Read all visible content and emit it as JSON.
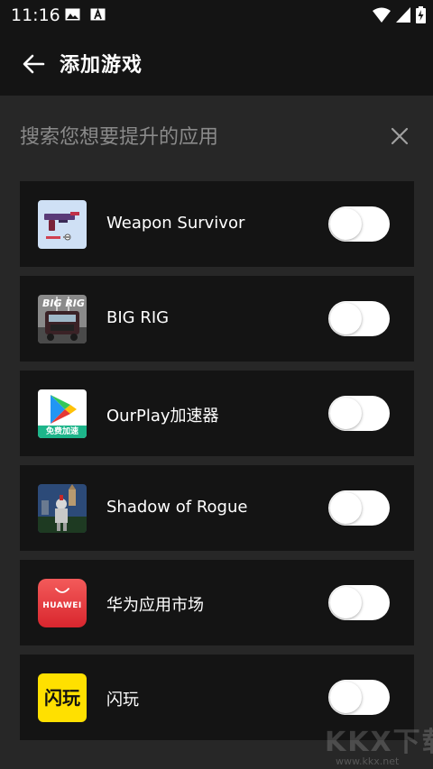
{
  "status_bar": {
    "time": "11:16"
  },
  "app_bar": {
    "title": "添加游戏"
  },
  "search": {
    "placeholder": "搜索您想要提升的应用",
    "value": ""
  },
  "apps": [
    {
      "name": "Weapon Survivor",
      "enabled": false,
      "icon": "weapon-survivor-icon"
    },
    {
      "name": "BIG RIG",
      "enabled": false,
      "icon": "big-rig-icon"
    },
    {
      "name": "OurPlay加速器",
      "enabled": false,
      "icon": "ourplay-icon"
    },
    {
      "name": "Shadow of Rogue",
      "enabled": false,
      "icon": "shadow-of-rogue-icon"
    },
    {
      "name": "华为应用市场",
      "enabled": false,
      "icon": "huawei-appgallery-icon"
    },
    {
      "name": "闪玩",
      "enabled": false,
      "icon": "shanwan-icon"
    }
  ],
  "icon_text": {
    "big_rig": "BIG RIG",
    "ourplay_banner": "免费加速",
    "huawei": "HUAWEI",
    "shanwan": "闪玩"
  },
  "colors": {
    "background": "#272727",
    "bar": "#141414",
    "row": "#141414",
    "toggle_off": "#ffffff",
    "huawei_red": "#e8393c",
    "shanwan_yellow": "#ffe000"
  },
  "watermark": {
    "text": "KKX下载",
    "url": "www.kkx.net"
  }
}
